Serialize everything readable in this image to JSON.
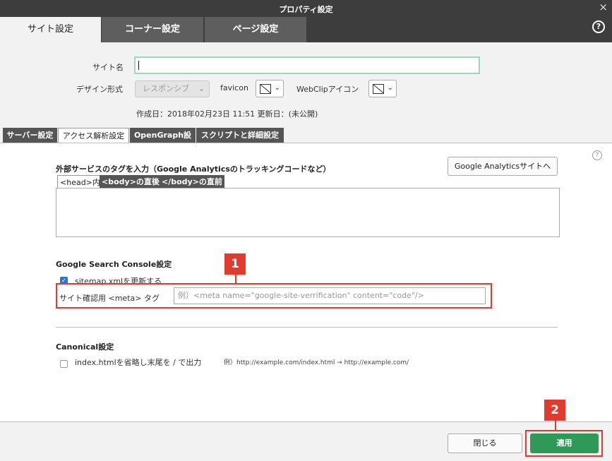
{
  "window": {
    "title": "プロパティ設定",
    "close_icon": "×"
  },
  "main_tabs": [
    {
      "label": "サイト設定"
    },
    {
      "label": "コーナー設定"
    },
    {
      "label": "ページ設定"
    }
  ],
  "help_icon": "?",
  "site": {
    "name_label": "サイト名",
    "name_value": "",
    "design_label": "デザイン形式",
    "design_value": "レスポンシブ",
    "favicon_label": "favicon",
    "webclip_label": "WebClipアイコン",
    "dates": "作成日：2018年02月23日 11:51 更新日：(未公開)"
  },
  "sub_tabs": [
    {
      "label": "サーバー設定"
    },
    {
      "label": "アクセス解析設定"
    },
    {
      "label": "OpenGraph設定"
    },
    {
      "label": "スクリプトと詳細設定"
    }
  ],
  "external": {
    "heading": "外部サービスのタグを入力（Google Analyticsのトラッキングコードなど）",
    "ga_button": "Google Analyticsサイトへ",
    "code_tabs": [
      {
        "label": "<head>内"
      },
      {
        "label": "<body>の直後"
      },
      {
        "label": "</body>の直前"
      }
    ]
  },
  "gsc": {
    "heading": "Google Search Console設定",
    "sitemap_label": "sitemap.xmlを更新する",
    "sitemap_checked": true,
    "meta_label": "サイト確認用 <meta> タグ",
    "meta_placeholder": "例）<meta name=\"google-site-verrification\" content=\"code\"/>"
  },
  "canonical": {
    "heading": "Canonical設定",
    "option_label": "index.htmlを省略し末尾を / で出力",
    "option_checked": false,
    "example": "例）http://example.com/index.html → http://example.com/"
  },
  "markers": {
    "one": "1",
    "two": "2"
  },
  "footer": {
    "close_label": "閉じる",
    "apply_label": "適用"
  },
  "colors": {
    "apply_green": "#2f9a57",
    "highlight_red": "#e13b30",
    "titlebar": "#3d3d3d"
  }
}
